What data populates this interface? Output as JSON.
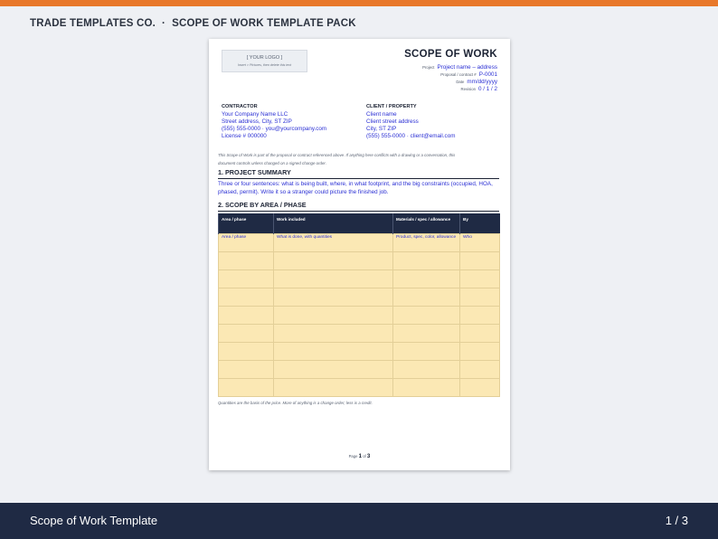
{
  "header": {
    "company": "TRADE TEMPLATES CO.",
    "separator": "·",
    "product": "SCOPE OF WORK TEMPLATE PACK"
  },
  "document": {
    "logo": {
      "line1": "[ YOUR LOGO ]",
      "line2": "Insert > Pictures, then delete this text"
    },
    "title": "SCOPE OF WORK",
    "meta": [
      {
        "label": "Project",
        "value": "Project name – address"
      },
      {
        "label": "Proposal / contract #",
        "value": "P-0001"
      },
      {
        "label": "Date",
        "value": "mm/dd/yyyy"
      },
      {
        "label": "Revision",
        "value": "0 / 1 / 2"
      }
    ],
    "contractor": {
      "heading": "CONTRACTOR",
      "lines": [
        "Your Company Name LLC",
        "Street address, City, ST ZIP",
        "(555) 555-0000 · you@yourcompany.com",
        "License # 000000"
      ]
    },
    "client": {
      "heading": "CLIENT / PROPERTY",
      "lines": [
        "Client name",
        "Client street address",
        "City, ST ZIP",
        "(555) 555-0000 · client@email.com"
      ]
    },
    "note": "This Scope of Work is part of the proposal or contract referenced above. If anything here conflicts with a drawing or a conversation, this document controls unless changed on a signed change order.",
    "section1": {
      "heading": "1. PROJECT SUMMARY",
      "text": "Three or four sentences: what is being built, where, in what footprint, and the big constraints (occupied, HOA, phased, permit). Write it so a stranger could picture the finished job."
    },
    "section2": {
      "heading": "2. SCOPE BY AREA / PHASE",
      "columns": [
        "Area / phase",
        "Work included",
        "Materials / spec / allowance",
        "By"
      ],
      "rows": [
        [
          "Area / phase",
          "What is done, with quantities",
          "Product, spec, color, allowance",
          "Who"
        ],
        [
          "",
          "",
          "",
          ""
        ],
        [
          "",
          "",
          "",
          ""
        ],
        [
          "",
          "",
          "",
          ""
        ],
        [
          "",
          "",
          "",
          ""
        ],
        [
          "",
          "",
          "",
          ""
        ],
        [
          "",
          "",
          "",
          ""
        ],
        [
          "",
          "",
          "",
          ""
        ],
        [
          "",
          "",
          "",
          ""
        ]
      ]
    },
    "footnote": "Quantities are the basis of the price. More of anything is a change order; less is a credit.",
    "page": {
      "prefix": "Page",
      "current": "1",
      "of": "of",
      "total": "3"
    }
  },
  "footer": {
    "title": "Scope of Work Template",
    "counter": "1 / 3"
  },
  "colors": {
    "accent": "#e8782a",
    "navy": "#1f2a44",
    "field_blue": "#2a2fd4",
    "table_fill": "#fbe8b4"
  }
}
